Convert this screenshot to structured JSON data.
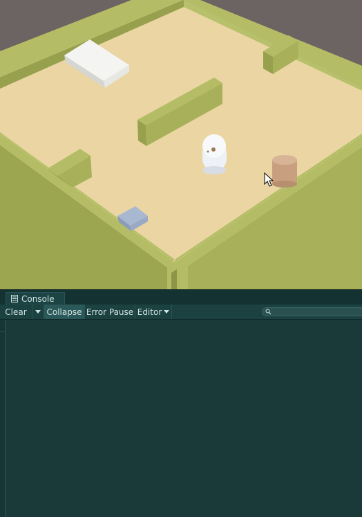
{
  "console": {
    "tab_label": "Console",
    "clear_label": "Clear",
    "collapse_label": "Collapse",
    "error_pause_label": "Error Pause",
    "editor_label": "Editor",
    "search_value": "",
    "collapse_active": true
  },
  "icons": {
    "tab": "console-icon",
    "clear_dropdown": "chevron-down-icon",
    "editor_dropdown": "chevron-down-icon",
    "search": "search-icon",
    "cursor": "mouse-pointer-icon"
  },
  "colors": {
    "floor": "#ead5a3",
    "wall": "#a9b35c",
    "background": "#6b6462",
    "console_bg": "#1a3a3a",
    "console_toolbar": "#1c4141"
  }
}
